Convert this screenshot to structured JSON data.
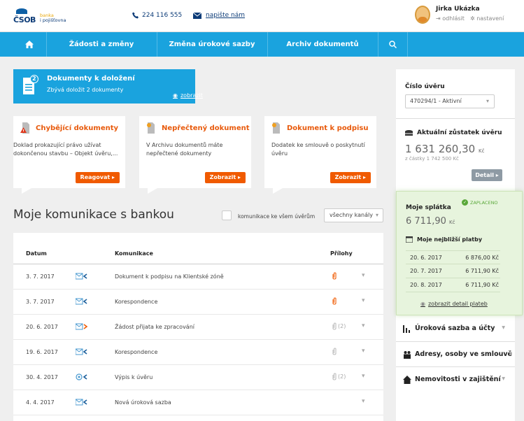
{
  "header": {
    "brand_main": "ČSOB",
    "brand_sub_1": "banka",
    "brand_sub_2": "i pojišťovna",
    "phone": "224 116 555",
    "mail_label": "napište nám",
    "user_name": "Jirka Ukázka",
    "logout_label": "odhlásit",
    "settings_label": "nastavení"
  },
  "nav": {
    "items": [
      "Žádosti a změny",
      "Změna úrokové sazby",
      "Archiv dokumentů"
    ]
  },
  "doc_banner": {
    "count": "2",
    "title": "Dokumenty k doložení",
    "subtitle": "Zbývá doložit 2 dokumenty",
    "show_label": "zobrazit"
  },
  "cards": [
    {
      "title": "Chybějící dokumenty",
      "desc_1": "Doklad prokazující právo užívat",
      "desc_2": "dokončenou stavbu – Objekt úvěru,...",
      "button": "Reagovat ▸"
    },
    {
      "title": "Nepřečtený dokument",
      "desc_1": "V Archivu dokumentů máte",
      "desc_2": "nepřečtené dokumenty",
      "button": "Zobrazit ▸"
    },
    {
      "title": "Dokument k podpisu",
      "desc_1": "Dodatek ke smlouvě o poskytnutí",
      "desc_2": "úvěru",
      "button": "Zobrazit ▸"
    }
  ],
  "communication": {
    "title": "Moje komunikace s bankou",
    "all_loans_label": "komunikace ke všem úvěrům",
    "channel_value": "všechny kanály",
    "columns": {
      "date": "Datum",
      "communication": "Komunikace",
      "attachments": "Přílohy"
    },
    "rows": [
      {
        "date": "3. 7. 2017",
        "text": "Dokument k podpisu na Klientské zóně",
        "attach": "",
        "attach_state": "active",
        "channel_icon": "mail-in-icon"
      },
      {
        "date": "3. 7. 2017",
        "text": "Korespondence",
        "attach": "",
        "attach_state": "active",
        "channel_icon": "mail-in-icon"
      },
      {
        "date": "20. 6. 2017",
        "text": "Žádost přijata ke zpracování",
        "attach": "(2)",
        "attach_state": "inactive",
        "channel_icon": "mail-out-icon"
      },
      {
        "date": "19. 6. 2017",
        "text": "Korespondence",
        "attach": "",
        "attach_state": "inactive",
        "channel_icon": "mail-in-icon"
      },
      {
        "date": "30. 4. 2017",
        "text": "Výpis k úvěru",
        "attach": "(2)",
        "attach_state": "inactive",
        "channel_icon": "email-in-icon"
      },
      {
        "date": "4. 4. 2017",
        "text": "Nová úroková sazba",
        "attach": "",
        "attach_state": "none",
        "channel_icon": "mail-in-icon"
      }
    ]
  },
  "sidebar": {
    "loan_number_label": "Číslo úvěru",
    "loan_select_value": "470294/1 - Aktivní",
    "balance_label": "Aktuální zůstatek úvěru",
    "balance_value": "1 631 260,30",
    "currency": "Kč",
    "balance_sub": "z částky 1 742 500 Kč",
    "detail_label": "Detail ▸",
    "payment": {
      "title": "Moje splátka",
      "paid_label": "ZAPLACENO",
      "amount": "6 711,90",
      "currency": "Kč",
      "next_title": "Moje nejbližší platby",
      "rows": [
        {
          "date": "20. 6. 2017",
          "amount": "6 876,00 Kč"
        },
        {
          "date": "20. 7. 2017",
          "amount": "6 711,90 Kč"
        },
        {
          "date": "20. 8. 2017",
          "amount": "6 711,90 Kč"
        }
      ],
      "link": "zobrazit detail plateb"
    },
    "sections": [
      "Úroková sazba a účty",
      "Adresy, osoby ve smlouvě",
      "Nemovitosti v zajištění"
    ]
  },
  "colors": {
    "accent": "#1aa3de",
    "orange": "#f05a00",
    "green": "#5aa83a"
  }
}
